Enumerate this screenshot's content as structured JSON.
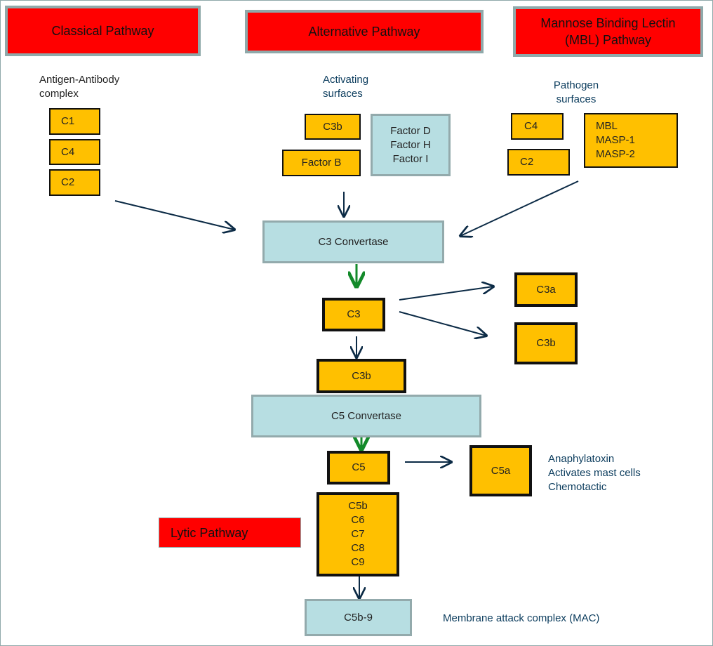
{
  "headers": {
    "classical": "Classical Pathway",
    "alternative": "Alternative Pathway",
    "mbl": [
      "Mannose Binding Lectin",
      "(MBL) Pathway"
    ],
    "lytic": "Lytic Pathway"
  },
  "classical": {
    "trigger": [
      "Antigen-Antibody",
      "complex"
    ],
    "components": [
      "C1",
      "C4",
      "C2"
    ]
  },
  "alternative": {
    "trigger": [
      "Activating",
      "surfaces"
    ],
    "c3b": "C3b",
    "factor_b": "Factor B",
    "factors": [
      "Factor D",
      "Factor H",
      "Factor I"
    ]
  },
  "mbl": {
    "trigger": [
      "Pathogen",
      "surfaces"
    ],
    "c4": "C4",
    "c2": "C2",
    "proteins": [
      "MBL",
      "MASP-1",
      "MASP-2"
    ]
  },
  "cascade": {
    "c3_convertase": "C3 Convertase",
    "c3": "C3",
    "c3a": "C3a",
    "c3b_right": "C3b",
    "c3b": "C3b",
    "c5_convertase": "C5 Convertase",
    "c5": "C5",
    "c5a": "C5a",
    "c5a_notes": [
      "Anaphylatoxin",
      "Activates mast cells",
      "Chemotactic"
    ],
    "terminal": [
      "C5b",
      "C6",
      "C7",
      "C8",
      "C9"
    ],
    "mac_box": "C5b-9",
    "mac_label": "Membrane attack complex (MAC)"
  },
  "colors": {
    "header": "#ff0000",
    "component": "#ffc000",
    "convertase": "#b7dee2",
    "arrow": "#0b2a45",
    "green_arrow": "#138a2a"
  }
}
